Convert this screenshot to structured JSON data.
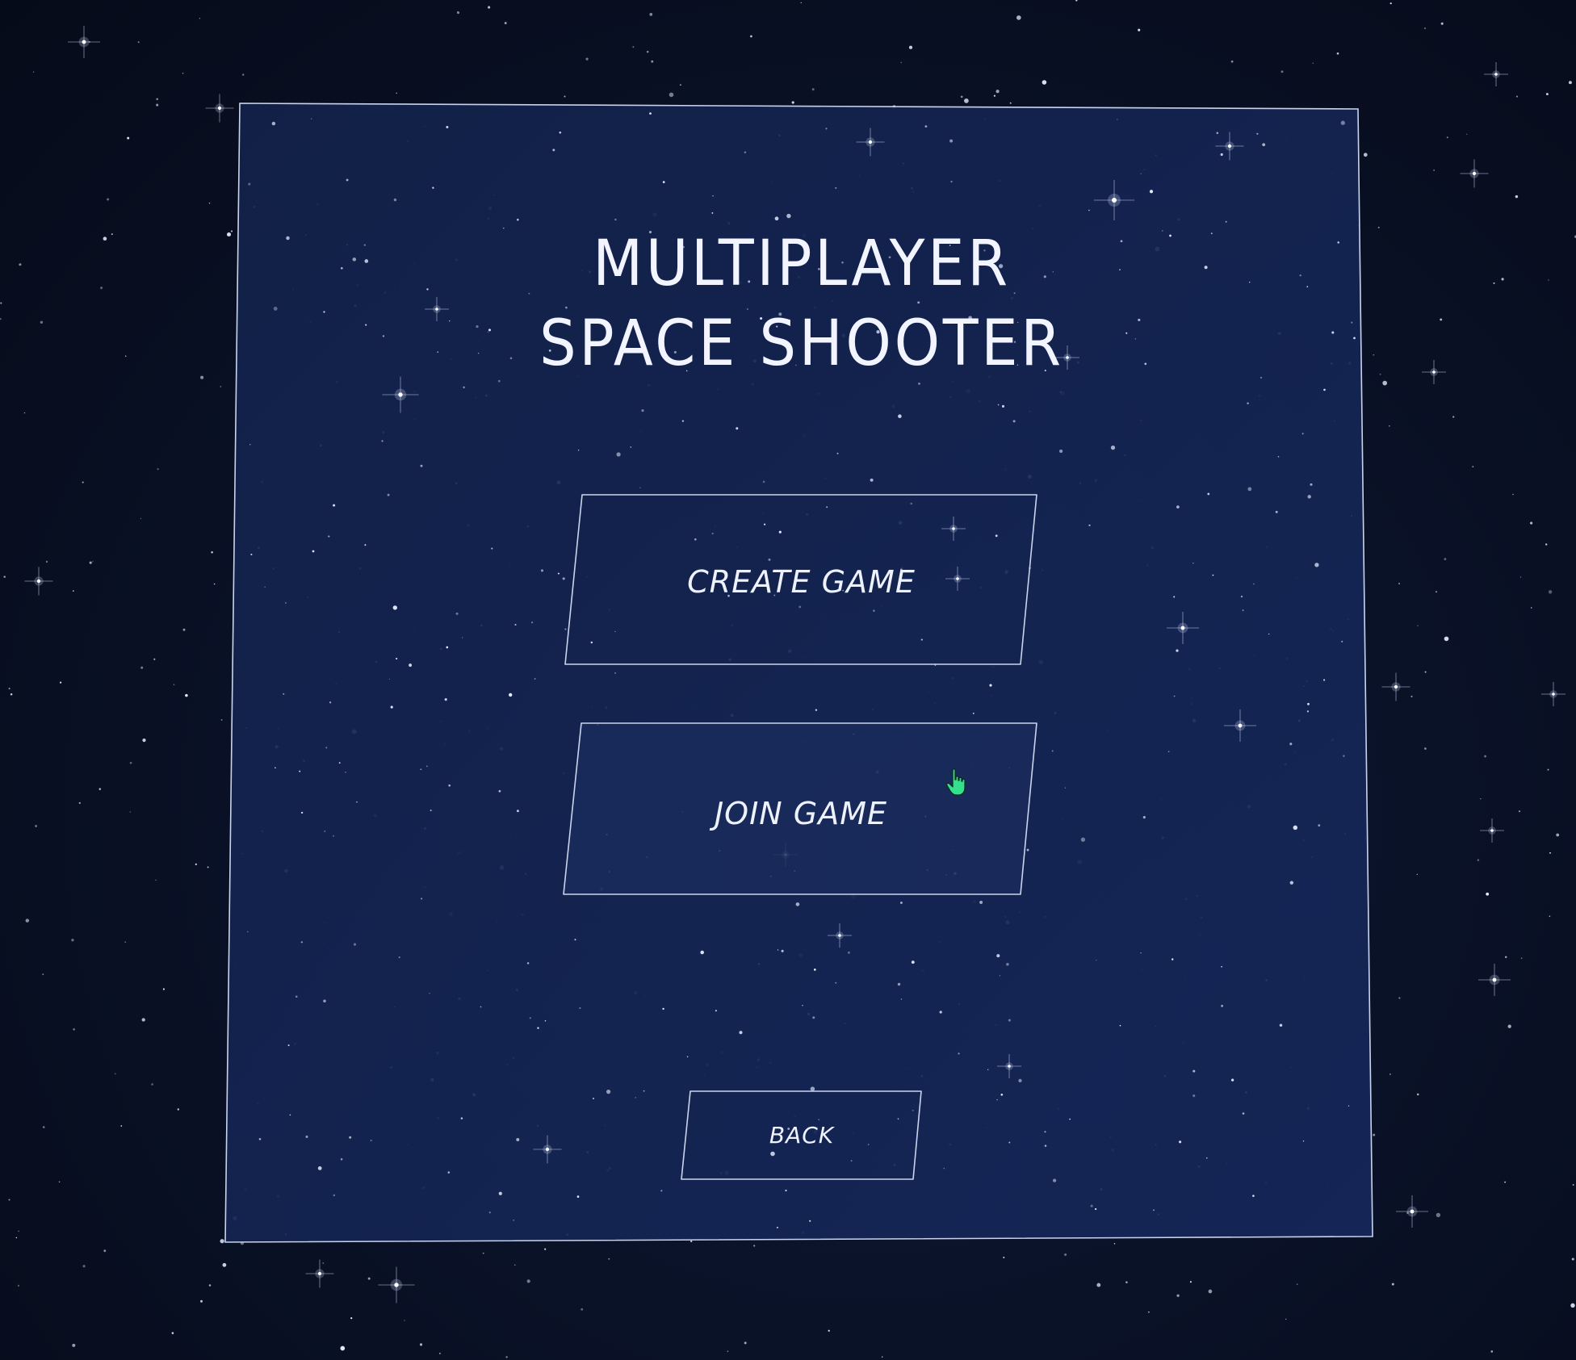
{
  "title": {
    "line1": "MULTIPLAYER",
    "line2": "SPACE SHOOTER"
  },
  "menu": {
    "create_label": "CREATE GAME",
    "join_label": "JOIN GAME",
    "back_label": "BACK",
    "hovered_item": "JOIN GAME"
  },
  "cursor": {
    "icon": "pointing-hand-cursor-icon",
    "color": "#33e08c"
  },
  "colors": {
    "background": "#070d1c",
    "panel_fill": "#12214a",
    "panel_border": "#c9d4ec",
    "button_hover_fill": "#1a2c5c",
    "text": "#f2f5ff"
  }
}
